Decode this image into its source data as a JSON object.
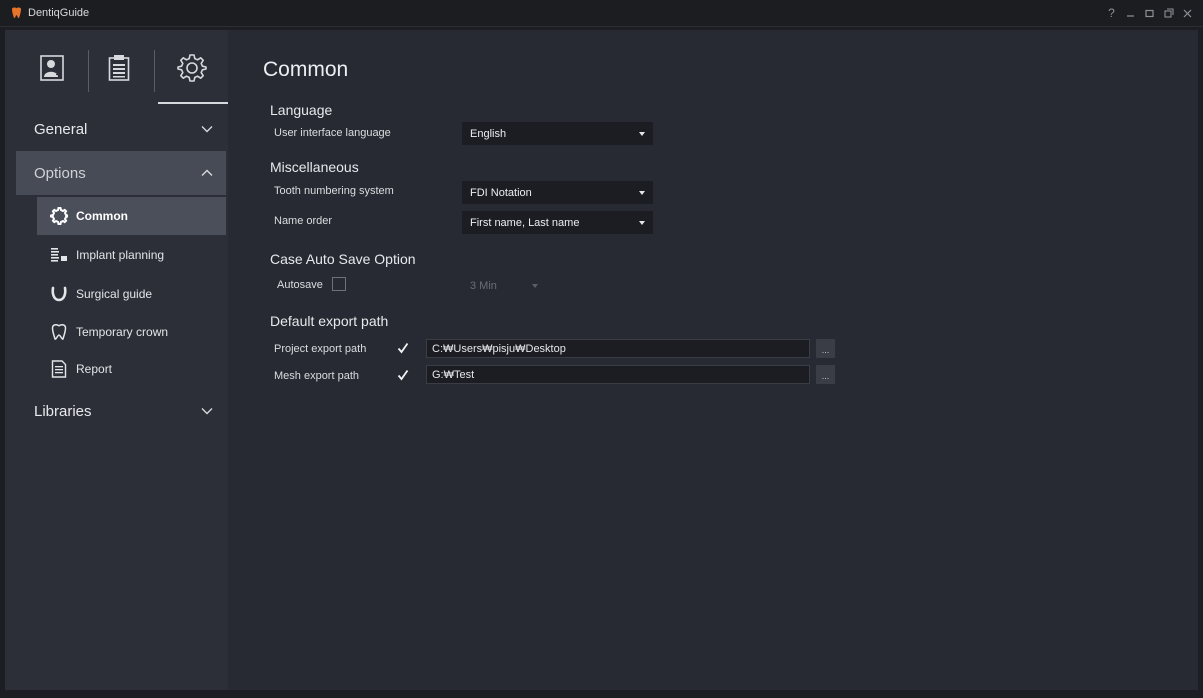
{
  "app": {
    "title": "DentiqGuide"
  },
  "window_controls": [
    "help-icon",
    "minimize-icon",
    "maximize-icon",
    "restore-icon",
    "close-icon"
  ],
  "window_help_glyph": "?",
  "sidebar": {
    "tabs": [
      {
        "icon": "patient-icon"
      },
      {
        "icon": "case-list-icon"
      },
      {
        "icon": "settings-icon",
        "active": true
      }
    ],
    "sections": {
      "general": {
        "label": "General",
        "expanded": false
      },
      "options": {
        "label": "Options",
        "expanded": true,
        "items": [
          {
            "label": "Common",
            "icon": "gear-icon",
            "active": true
          },
          {
            "label": "Implant planning",
            "icon": "implant-planning-icon"
          },
          {
            "label": "Surgical guide",
            "icon": "surgical-guide-icon"
          },
          {
            "label": "Temporary crown",
            "icon": "tooth-icon"
          },
          {
            "label": "Report",
            "icon": "report-icon"
          }
        ]
      },
      "libraries": {
        "label": "Libraries",
        "expanded": false
      }
    }
  },
  "main": {
    "title": "Common",
    "language": {
      "heading": "Language",
      "ui_language_label": "User interface language",
      "ui_language_value": "English"
    },
    "misc": {
      "heading": "Miscellaneous",
      "tooth_numbering_label": "Tooth numbering system",
      "tooth_numbering_value": "FDI Notation",
      "name_order_label": "Name order",
      "name_order_value": "First name, Last name"
    },
    "autosave": {
      "heading": "Case Auto Save Option",
      "label": "Autosave",
      "checked": false,
      "interval_value": "3 Min"
    },
    "export": {
      "heading": "Default export path",
      "project_label": "Project export path",
      "project_checked": true,
      "project_path": "C:₩Users₩pisju₩Desktop",
      "mesh_label": "Mesh export path",
      "mesh_checked": true,
      "mesh_path": "G:₩Test",
      "browse_label": "..."
    }
  },
  "colors": {
    "background": "#1c1e24",
    "panel": "#272a33",
    "sidebar": "#2c2f38",
    "active_section": "#474b55",
    "active_item": "#4b4f5a",
    "logo": "#e8742a"
  }
}
